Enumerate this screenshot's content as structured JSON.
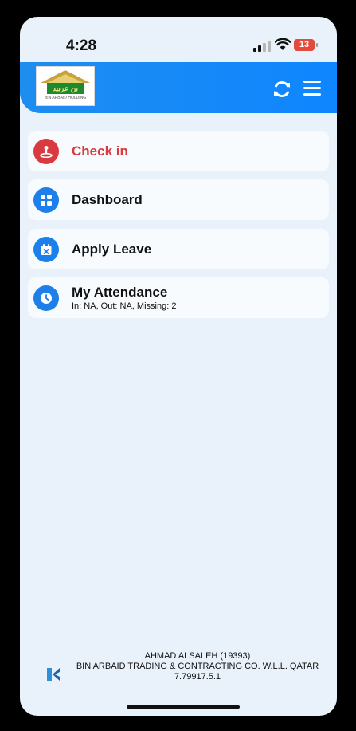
{
  "status_bar": {
    "time": "4:28",
    "battery": "13"
  },
  "header": {
    "logo_text": "بن عربيد",
    "logo_tagline": "BIN ARBAID HOLDING",
    "brand_color": "#1e8df0"
  },
  "menu_items": [
    {
      "label": "Check in",
      "icon": "person-pin-icon",
      "color": "#d83a3f"
    },
    {
      "label": "Dashboard",
      "icon": "grid-icon",
      "color": "#1d7fea"
    },
    {
      "label": "Apply Leave",
      "icon": "calendar-x-icon",
      "color": "#1d7fea"
    },
    {
      "label": "My Attendance",
      "sublabel": "In: NA, Out: NA, Missing: 2",
      "icon": "clock-icon",
      "color": "#1d7fea"
    }
  ],
  "footer": {
    "user": "AHMAD ALSALEH (19393)",
    "company": "BIN ARBAID TRADING & CONTRACTING CO. W.L.L. QATAR",
    "version": "7.79917.5.1"
  }
}
